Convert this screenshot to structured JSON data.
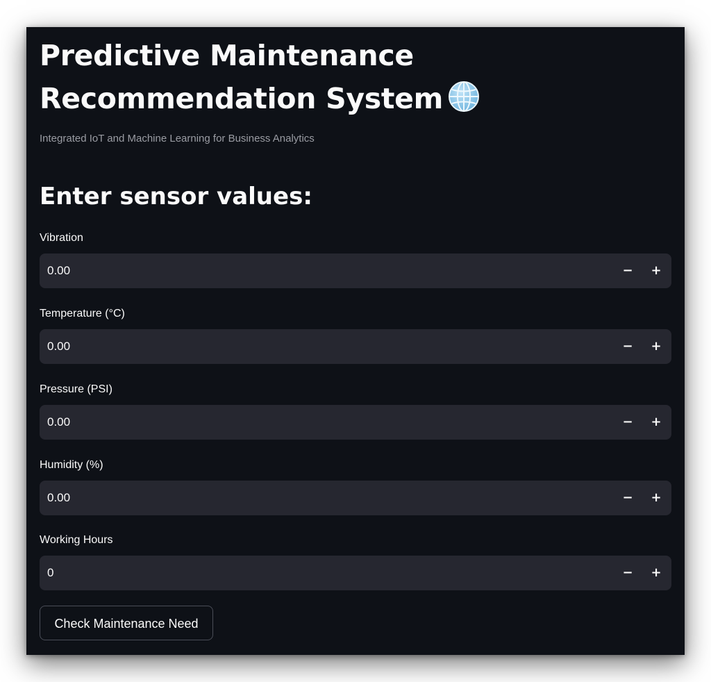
{
  "header": {
    "title": "Predictive Maintenance Recommendation System",
    "title_icon": "globe-icon",
    "subtitle": "Integrated IoT and Machine Learning for Business Analytics"
  },
  "form": {
    "heading": "Enter sensor values:",
    "fields": [
      {
        "label": "Vibration",
        "value": "0.00",
        "decrement_label": "−",
        "increment_label": "+"
      },
      {
        "label": "Temperature (°C)",
        "value": "0.00",
        "decrement_label": "−",
        "increment_label": "+"
      },
      {
        "label": "Pressure (PSI)",
        "value": "0.00",
        "decrement_label": "−",
        "increment_label": "+"
      },
      {
        "label": "Humidity (%)",
        "value": "0.00",
        "decrement_label": "−",
        "increment_label": "+"
      },
      {
        "label": "Working Hours",
        "value": "0",
        "decrement_label": "−",
        "increment_label": "+"
      }
    ],
    "submit_label": "Check Maintenance Need"
  },
  "colors": {
    "background": "#0e1117",
    "input_background": "#262730",
    "text": "#fafafa",
    "muted_text": "#9a9ca3"
  }
}
